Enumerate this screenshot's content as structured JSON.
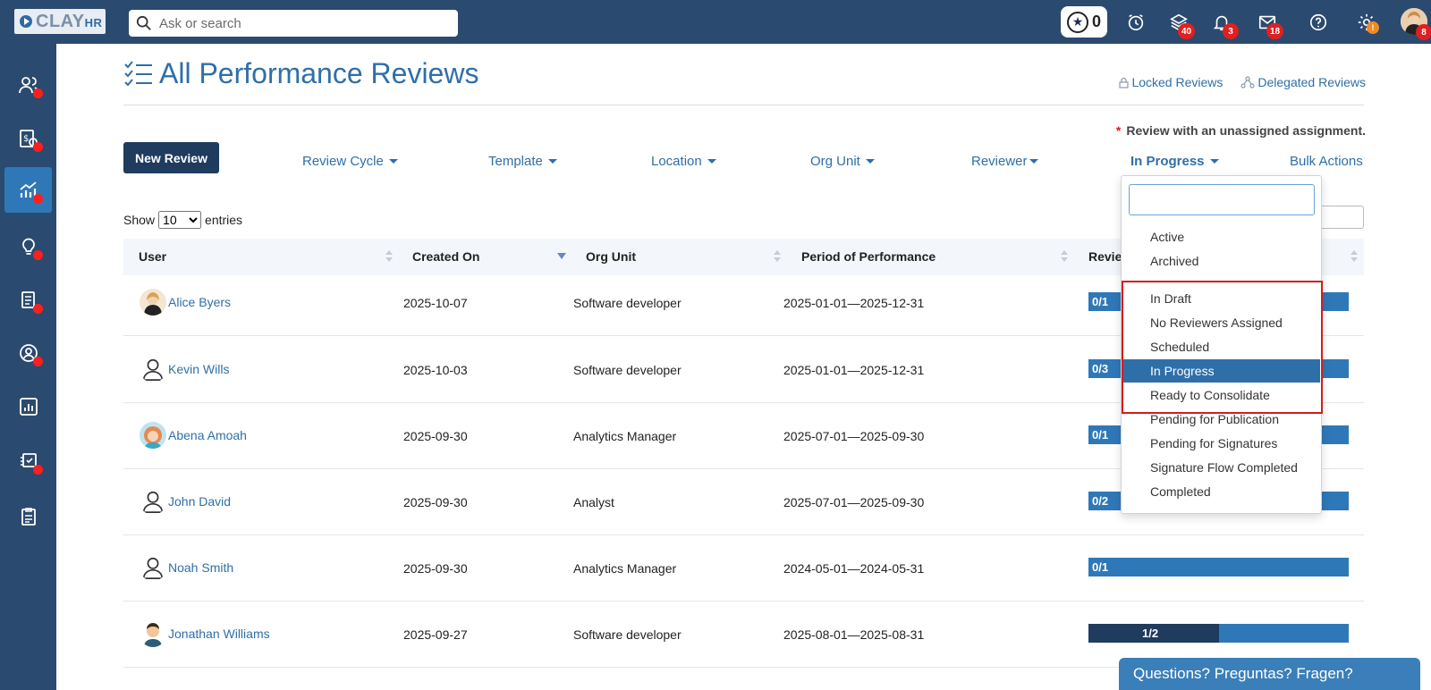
{
  "app": {
    "logo_main": "CLAY",
    "logo_sub": "HR",
    "search_placeholder": "Ask or search"
  },
  "topbar": {
    "star_count": "0",
    "icons": [
      {
        "name": "alarm-clock-icon",
        "badge": ""
      },
      {
        "name": "layers-icon",
        "badge": "40"
      },
      {
        "name": "bell-icon",
        "badge": "3"
      },
      {
        "name": "mail-icon",
        "badge": "18"
      },
      {
        "name": "help-icon",
        "badge": ""
      },
      {
        "name": "gear-icon",
        "badge": "!"
      }
    ],
    "avatar_badge": "8"
  },
  "sidebar": {
    "items": [
      {
        "name": "people-icon",
        "dot": true
      },
      {
        "name": "payroll-icon",
        "dot": true
      },
      {
        "name": "performance-icon",
        "dot": true,
        "active": true
      },
      {
        "name": "lightbulb-icon",
        "dot": true
      },
      {
        "name": "documents-icon",
        "dot": true
      },
      {
        "name": "profile-icon",
        "dot": true
      },
      {
        "name": "reports-icon",
        "dot": false
      },
      {
        "name": "training-icon",
        "dot": true
      },
      {
        "name": "checklist-icon",
        "dot": false
      }
    ]
  },
  "page": {
    "title": "All Performance Reviews",
    "locked_reviews": "Locked Reviews",
    "delegated_reviews": "Delegated Reviews",
    "note_asterisk": "*",
    "note_text": "Review with an unassigned assignment.",
    "new_review": "New Review",
    "filters": {
      "review_cycle": "Review Cycle",
      "template": "Template",
      "location": "Location",
      "org_unit": "Org Unit",
      "reviewer": "Reviewer",
      "status": "In Progress",
      "bulk_actions": "Bulk Actions"
    },
    "show_label": "Show",
    "entries_label": "entries",
    "entries_value": "10"
  },
  "table": {
    "headers": {
      "user": "User",
      "created_on": "Created On",
      "org_unit": "Org Unit",
      "period": "Period of Performance",
      "review": "Revie"
    },
    "rows": [
      {
        "user": "Alice Byers",
        "avatar": "photo-f1",
        "created": "2025-10-07",
        "org": "Software developer",
        "period": "2025-01-01—2025-12-31",
        "progress": "0/1",
        "fraction": 0
      },
      {
        "user": "Kevin Wills",
        "avatar": "placeholder",
        "created": "2025-10-03",
        "org": "Software developer",
        "period": "2025-01-01—2025-12-31",
        "progress": "0/3",
        "fraction": 0
      },
      {
        "user": "Abena Amoah",
        "avatar": "photo-f2",
        "created": "2025-09-30",
        "org": "Analytics Manager",
        "period": "2025-07-01—2025-09-30",
        "progress": "0/1",
        "fraction": 0
      },
      {
        "user": "John David",
        "avatar": "placeholder",
        "created": "2025-09-30",
        "org": "Analyst",
        "period": "2025-07-01—2025-09-30",
        "progress": "0/2",
        "fraction": 0
      },
      {
        "user": "Noah Smith",
        "avatar": "placeholder",
        "created": "2025-09-30",
        "org": "Analytics Manager",
        "period": "2024-05-01—2024-05-31",
        "progress": "0/1",
        "fraction": 0
      },
      {
        "user": "Jonathan Williams",
        "avatar": "photo-m1",
        "created": "2025-09-27",
        "org": "Software developer",
        "period": "2025-08-01—2025-08-31",
        "progress": "1/2",
        "fraction": 0.5
      }
    ]
  },
  "dropdown": {
    "search_value": "",
    "items": [
      "Active",
      "Archived",
      "In Draft",
      "No Reviewers Assigned",
      "Scheduled",
      "In Progress",
      "Ready to Consolidate",
      "Pending for Publication",
      "Pending for Signatures",
      "Signature Flow Completed",
      "Completed"
    ],
    "selected": "In Progress"
  },
  "help": {
    "label": "Questions? Preguntas? Fragen?"
  },
  "colors": {
    "topbar": "#2b4a6f",
    "accent": "#2f6fa8",
    "progress": "#2f78b8",
    "progress_done": "#1f3b5e",
    "highlight": "#d41d1d"
  }
}
